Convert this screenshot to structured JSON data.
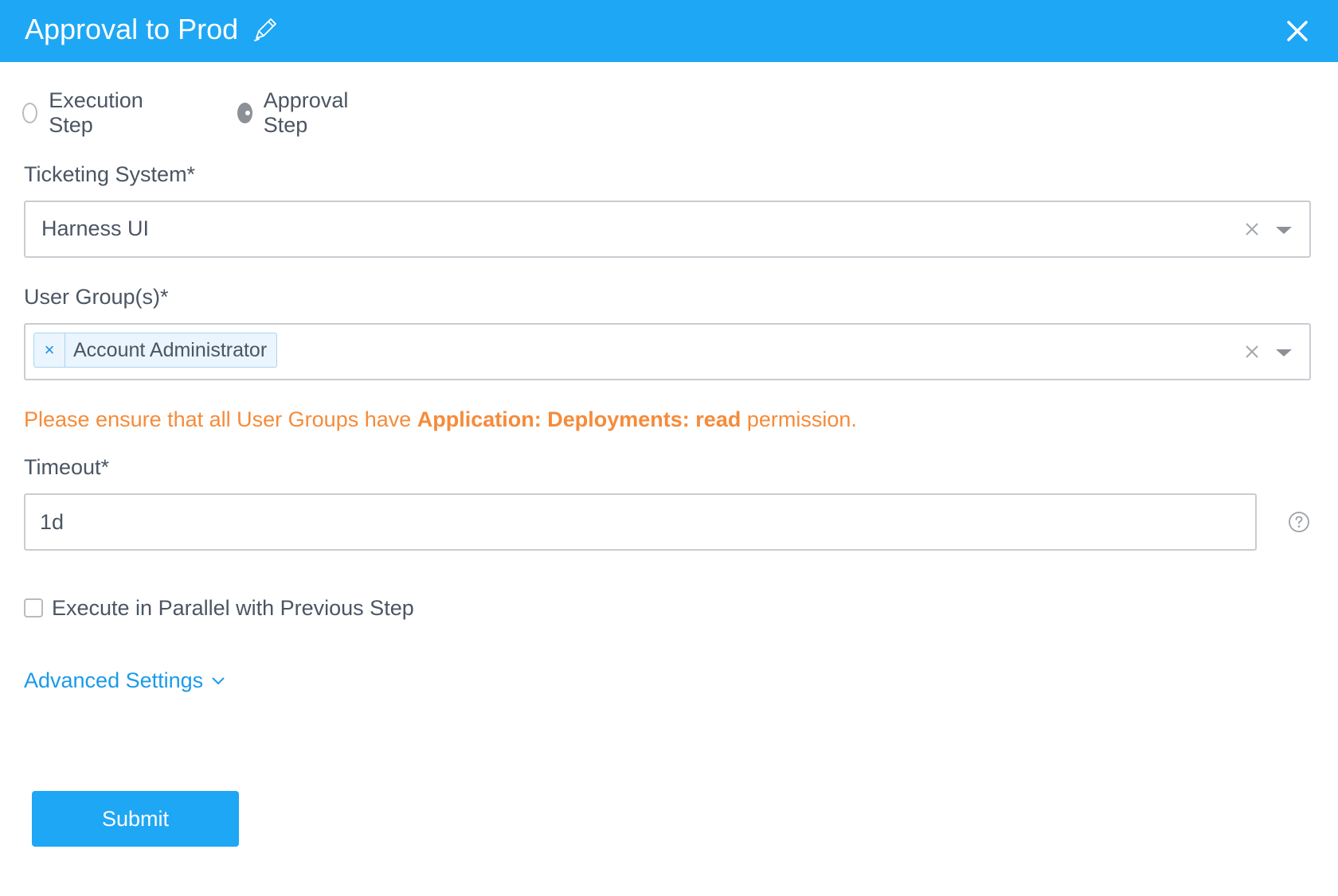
{
  "header": {
    "title": "Approval to Prod",
    "edit_icon": "pencil-icon",
    "close_icon": "close-icon",
    "background": "#1ea7f5"
  },
  "step_type": {
    "options": [
      {
        "label": "Execution Step",
        "selected": false
      },
      {
        "label": "Approval Step",
        "selected": true
      }
    ]
  },
  "ticketing_system": {
    "label": "Ticketing System*",
    "value": "Harness UI"
  },
  "user_groups": {
    "label": "User Group(s)*",
    "tags": [
      "Account Administrator"
    ],
    "tag_remove_symbol": "×"
  },
  "warning": {
    "prefix": "Please ensure that all User Groups have ",
    "emphasis": "Application: Deployments: read",
    "suffix": " permission.",
    "color": "#f58b3a"
  },
  "timeout": {
    "label": "Timeout*",
    "value": "1d",
    "help_icon": "question-circle-icon"
  },
  "parallel": {
    "label": "Execute in Parallel with Previous Step",
    "checked": false
  },
  "advanced": {
    "label": "Advanced Settings",
    "icon": "chevron-down-icon"
  },
  "actions": {
    "submit_label": "Submit"
  }
}
